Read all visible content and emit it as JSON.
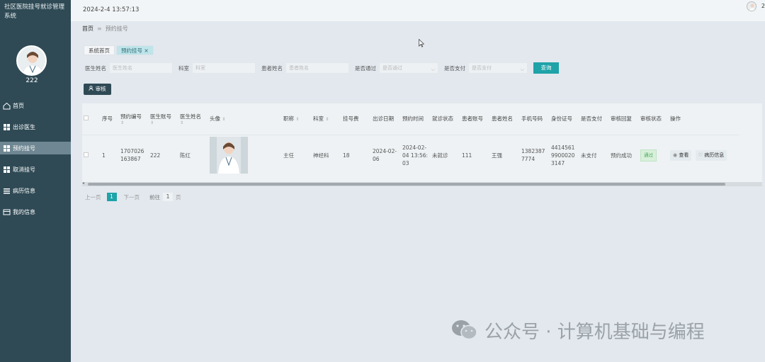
{
  "app": {
    "title": "社区医院挂号就诊管理系统"
  },
  "user": {
    "name": "222"
  },
  "sidebar": {
    "items": [
      {
        "label": "首页",
        "icon": "home-icon",
        "active": false
      },
      {
        "label": "出诊医生",
        "icon": "grid-icon",
        "active": false
      },
      {
        "label": "预约挂号",
        "icon": "grid-icon",
        "active": true
      },
      {
        "label": "取消挂号",
        "icon": "grid-icon",
        "active": false
      },
      {
        "label": "病历信息",
        "icon": "list-icon",
        "active": false
      },
      {
        "label": "我的信息",
        "icon": "card-icon",
        "active": false
      }
    ]
  },
  "header": {
    "datetime": "2024-2-4 13:57:13",
    "avatar_text": "2"
  },
  "breadcrumb": {
    "home": "首页",
    "sep": "≡",
    "current": "预约挂号"
  },
  "tabs": [
    {
      "label": "系统首页",
      "active": false
    },
    {
      "label": "预约挂号 ×",
      "active": true
    }
  ],
  "filter": {
    "doctor_name_label": "医生姓名",
    "doctor_name_placeholder": "医生姓名",
    "dept_label": "科室",
    "dept_placeholder": "科室",
    "patient_name_label": "患者姓名",
    "patient_name_placeholder": "患者姓名",
    "passed_label": "是否通过",
    "passed_placeholder": "是否通过",
    "paid_label": "是否支付",
    "paid_placeholder": "是否支付",
    "query_button": "查询"
  },
  "toolbar": {
    "audit_button": "审核"
  },
  "table": {
    "columns": [
      "序号",
      "预约编号",
      "医生账号",
      "医生姓名",
      "头像",
      "职称",
      "科室",
      "挂号费",
      "出诊日期",
      "预约时间",
      "就诊状态",
      "患者账号",
      "患者姓名",
      "手机号码",
      "身份证号",
      "是否支付",
      "审核回复",
      "审核状态",
      "操作"
    ],
    "rows": [
      {
        "index": "1",
        "appt_no": "1707026163867",
        "doctor_account": "222",
        "doctor_name": "陈红",
        "title": "主任",
        "dept": "神经科",
        "fee": "18",
        "visit_date": "2024-02-06",
        "appt_time": "2024-02-04 13:56:03",
        "visit_status": "未就诊",
        "patient_account": "111",
        "patient_name": "王强",
        "phone": "13823877774",
        "id_card": "441456199000203147",
        "paid": "未支付",
        "audit_reply": "预约成功",
        "audit_status": "通过",
        "op_view": "查看",
        "op_record": "病历信息"
      }
    ]
  },
  "pager": {
    "prev": "上一页",
    "current": "1",
    "next": "下一页",
    "goto_label": "前往",
    "goto_value": "1",
    "page_suffix": "页"
  },
  "watermark": {
    "text": "公众号 · 计算机基础与编程"
  },
  "colors": {
    "sidebar": "#2f4a55",
    "accent": "#1ea3a8",
    "success": "#46a85a"
  }
}
